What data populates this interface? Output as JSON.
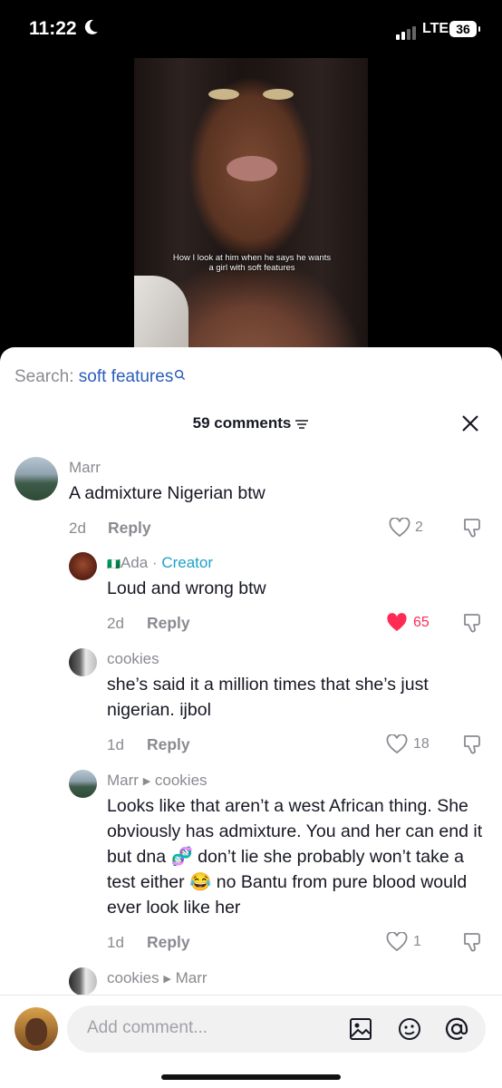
{
  "status": {
    "time": "11:22",
    "network": "LTE",
    "battery": "36"
  },
  "video": {
    "caption": "How I look at him when he says he wants a girl with soft features"
  },
  "search": {
    "label": "Search:",
    "term": "soft features"
  },
  "header": {
    "count_label": "59 comments"
  },
  "comments": [
    {
      "user": "Marr",
      "text": "A admixture Nigerian btw",
      "date": "2d",
      "reply": "Reply",
      "likes": "2"
    },
    {
      "user": "Ada",
      "badge": "Creator",
      "sep": " · ",
      "text": "Loud and wrong btw",
      "date": "2d",
      "reply": "Reply",
      "likes": "65",
      "liked": true,
      "like_color": "#fe2c55"
    },
    {
      "user": "cookies",
      "text": "she’s said it a million times that she’s just nigerian. ijbol",
      "date": "1d",
      "reply": "Reply",
      "likes": "18"
    },
    {
      "user": "Marr",
      "reply_to": "cookies",
      "text": "Looks like that aren’t a west African thing. She obviously has admixture. You and her can end it but dna 🧬 don’t lie she probably won’t take a test either 😂 no Bantu from pure blood would ever look like her",
      "date": "1d",
      "reply": "Reply",
      "likes": "1"
    },
    {
      "user": "cookies",
      "reply_to": "Marr"
    }
  ],
  "input": {
    "placeholder": "Add comment..."
  },
  "icons": {
    "image": "image-icon",
    "emoji": "emoji-icon",
    "mention": "at-icon"
  }
}
